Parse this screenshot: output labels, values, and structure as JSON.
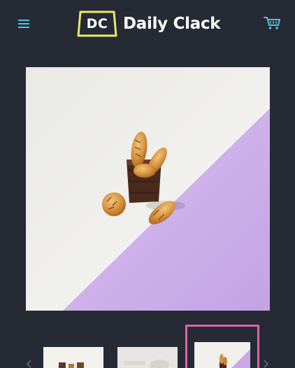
{
  "header": {
    "logo_badge": "DC",
    "logo_text": "Daily Clack",
    "menu_icon": "hamburger-menu-icon",
    "cart_icon": "shopping-cart-icon"
  },
  "colors": {
    "background": "#262a34",
    "accent_cyan": "#4fc3df",
    "logo_badge_outline": "#e8ea6a",
    "thumbnail_selected_border": "#e062a8",
    "image_white": "#f4f3f0",
    "image_lavender": "#c9a8e8"
  },
  "gallery": {
    "selected_index": 3,
    "thumbnail_count_visible": 3,
    "prev_icon": "chevron-left-icon",
    "next_icon": "chevron-right-icon"
  }
}
